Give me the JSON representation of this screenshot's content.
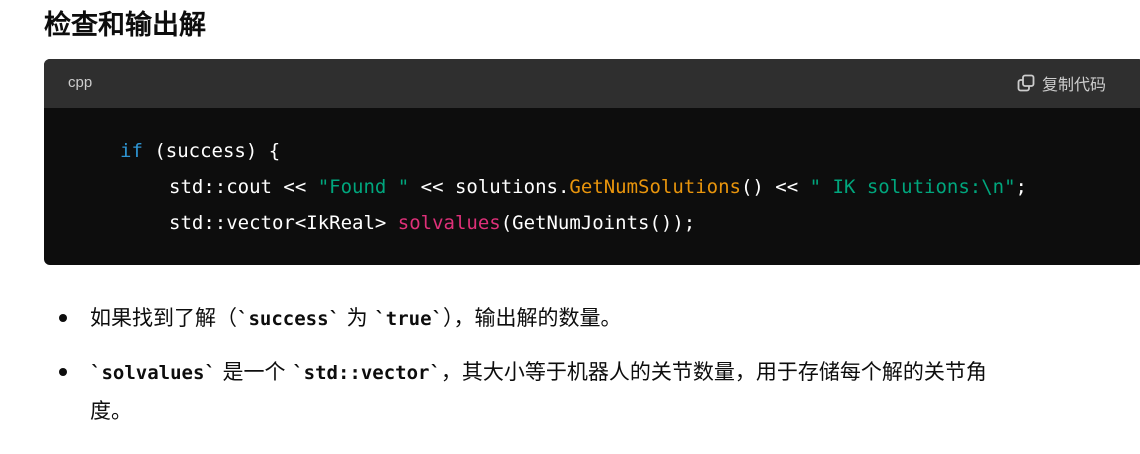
{
  "heading": "检查和输出解",
  "code_block": {
    "language": "cpp",
    "copy_label": "复制代码",
    "copy_icon": "copy-icon",
    "lines": [
      {
        "tokens": [
          {
            "text": "if",
            "kind": "keyword"
          },
          {
            "text": " (success) {",
            "kind": "plain"
          }
        ]
      },
      {
        "tokens": [
          {
            "text": "std::cout << ",
            "kind": "plain"
          },
          {
            "text": "\"Found \"",
            "kind": "string"
          },
          {
            "text": " << solutions.",
            "kind": "plain"
          },
          {
            "text": "GetNumSolutions",
            "kind": "function"
          },
          {
            "text": "() << ",
            "kind": "plain"
          },
          {
            "text": "\" IK solutions:\\n\"",
            "kind": "string"
          },
          {
            "text": ";",
            "kind": "plain"
          }
        ]
      },
      {
        "tokens": [
          {
            "text": "std::vector<IkReal> ",
            "kind": "plain"
          },
          {
            "text": "solvalues",
            "kind": "title"
          },
          {
            "text": "(GetNumJoints());",
            "kind": "plain"
          }
        ]
      }
    ]
  },
  "bullets": [
    {
      "segments": [
        {
          "text": "如果找到了解（",
          "code": false
        },
        {
          "text": "`success`",
          "code": true
        },
        {
          "text": " 为 ",
          "code": false
        },
        {
          "text": "`true`",
          "code": true
        },
        {
          "text": "），输出解的数量。",
          "code": false
        }
      ]
    },
    {
      "segments": [
        {
          "text": "`solvalues`",
          "code": true
        },
        {
          "text": " 是一个 ",
          "code": false
        },
        {
          "text": "`std::vector`",
          "code": true
        },
        {
          "text": "，其大小等于机器人的关节数量，用于存储每个解的关节角",
          "code": false
        }
      ],
      "continuation": "度。"
    }
  ],
  "colors": {
    "keyword": "#2e95d3",
    "string": "#00a67d",
    "function": "#e9950c",
    "title": "#df3079",
    "code_bg": "#0d0d0d",
    "code_header_bg": "#2f2f2f"
  }
}
